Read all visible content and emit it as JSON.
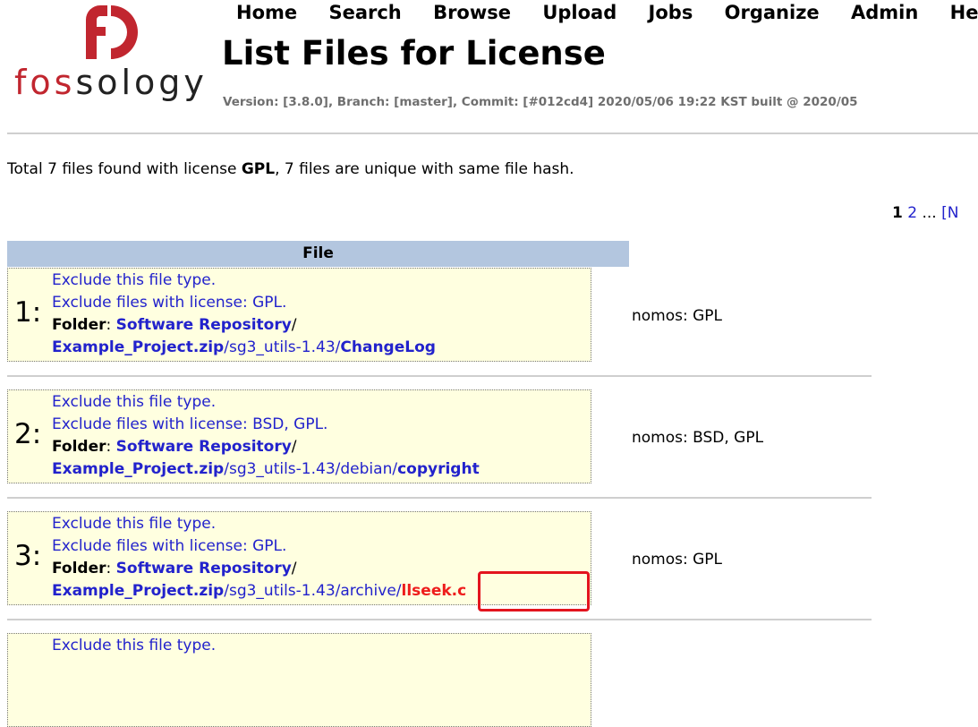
{
  "app": {
    "logo_text": "fossology",
    "title": "List Files for License",
    "version_line": "Version: [3.8.0], Branch: [master], Commit: [#012cd4] 2020/05/06 19:22 KST built @ 2020/05"
  },
  "nav": [
    {
      "label": "Home"
    },
    {
      "label": "Search"
    },
    {
      "label": "Browse"
    },
    {
      "label": "Upload"
    },
    {
      "label": "Jobs"
    },
    {
      "label": "Organize"
    },
    {
      "label": "Admin"
    },
    {
      "label": "Hel"
    }
  ],
  "summary": {
    "pre": "Total 7 files found with license ",
    "license": "GPL",
    "post": ", 7 files are unique with same file hash."
  },
  "pager": {
    "current": "1",
    "page2": "2",
    "ellipsis": " ... ",
    "next": "[N"
  },
  "table": {
    "header": "File"
  },
  "rows": [
    {
      "num": "1:",
      "exclude_type": "Exclude this file type.",
      "exclude_license": "Exclude files with license: GPL.",
      "folder_label": "Folder",
      "folder_name": "Software Repository",
      "upload": "Example_Project.zip",
      "path_mid": "/sg3_utils-1.43/",
      "filename": "ChangeLog",
      "license": "nomos: GPL"
    },
    {
      "num": "2:",
      "exclude_type": "Exclude this file type.",
      "exclude_license": "Exclude files with license: BSD, GPL.",
      "folder_label": "Folder",
      "folder_name": "Software Repository",
      "upload": "Example_Project.zip",
      "path_mid": "/sg3_utils-1.43/debian/",
      "filename": "copyright",
      "license": "nomos: BSD, GPL"
    },
    {
      "num": "3:",
      "exclude_type": "Exclude this file type.",
      "exclude_license": "Exclude files with license: GPL.",
      "folder_label": "Folder",
      "folder_name": "Software Repository",
      "upload": "Example_Project.zip",
      "path_mid": "/sg3_utils-1.43/archive/",
      "filename": "llseek.c",
      "license": "nomos: GPL"
    },
    {
      "num": "",
      "exclude_type": "Exclude this file type.",
      "exclude_license": "",
      "folder_label": "",
      "folder_name": "",
      "upload": "",
      "path_mid": "",
      "filename": "",
      "license": ""
    }
  ],
  "colors": {
    "brand_red": "#c1262f",
    "link_blue": "#2222cc",
    "header_blue": "#b3c6df",
    "row_bg": "#ffffe0",
    "highlight_red": "#e3141e"
  }
}
